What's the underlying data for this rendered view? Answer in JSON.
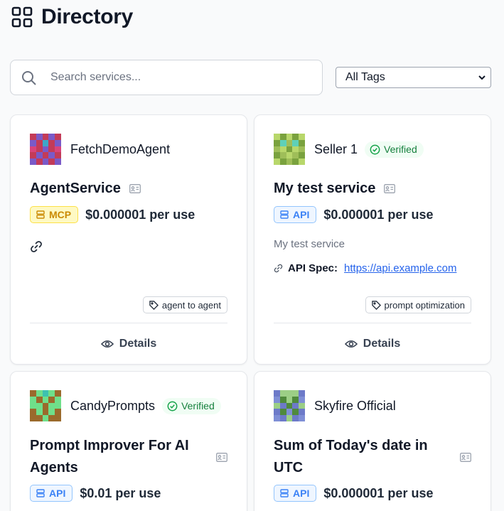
{
  "header": {
    "title": "Directory",
    "icon": "grid-icon"
  },
  "search": {
    "placeholder": "Search services...",
    "value": ""
  },
  "filter": {
    "selected": "All Tags"
  },
  "cards": [
    {
      "provider": "FetchDemoAgent",
      "verified": false,
      "title": "AgentService",
      "type": "MCP",
      "price": "$0.000001 per use",
      "tag": "agent to agent",
      "details_label": "Details",
      "avatar_colors": [
        "#9b3f86",
        "#c33b58",
        "#7a5ac8",
        "#3da7c8",
        "#d8447c"
      ]
    },
    {
      "provider": "Seller 1",
      "verified": true,
      "verified_label": "Verified",
      "title": "My test service",
      "type": "API",
      "price": "$0.000001 per use",
      "description": "My test service",
      "spec_label": "API Spec:",
      "spec_url": "https://api.example.com",
      "tag": "prompt optimization",
      "details_label": "Details",
      "avatar_colors": [
        "#9fbe59",
        "#b8d76b",
        "#5fd0b8",
        "#7aa23e"
      ]
    },
    {
      "provider": "CandyPrompts",
      "verified": true,
      "verified_label": "Verified",
      "title_line1": "Prompt Improver For AI",
      "title_line2": "Agents",
      "type": "API",
      "price": "$0.01 per use",
      "avatar_colors": [
        "#6fdf8a",
        "#9a6a2c",
        "#3dc1b0"
      ]
    },
    {
      "provider": "Skyfire Official",
      "verified": false,
      "title_line1": "Sum of Today's date in",
      "title_line2": "UTC",
      "type": "API",
      "price": "$0.000001 per use",
      "avatar_colors": [
        "#6d7ac9",
        "#9ccf86",
        "#4f8a3c",
        "#7f8fd6"
      ]
    }
  ]
}
